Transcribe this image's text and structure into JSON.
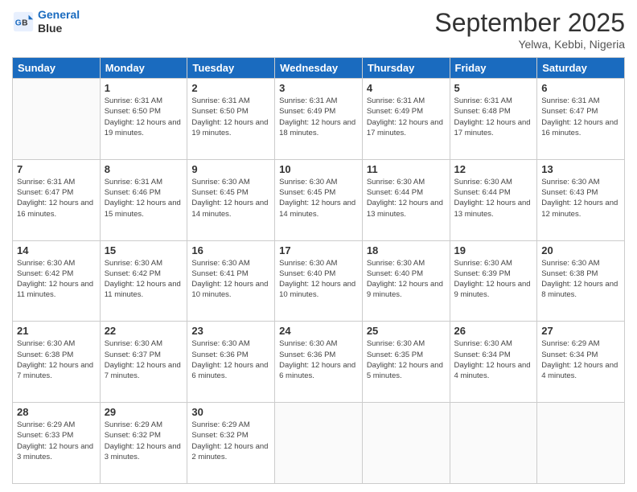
{
  "logo": {
    "line1": "General",
    "line2": "Blue"
  },
  "header": {
    "month": "September 2025",
    "location": "Yelwa, Kebbi, Nigeria"
  },
  "weekdays": [
    "Sunday",
    "Monday",
    "Tuesday",
    "Wednesday",
    "Thursday",
    "Friday",
    "Saturday"
  ],
  "weeks": [
    [
      {
        "day": "",
        "sunrise": "",
        "sunset": "",
        "daylight": ""
      },
      {
        "day": "1",
        "sunrise": "Sunrise: 6:31 AM",
        "sunset": "Sunset: 6:50 PM",
        "daylight": "Daylight: 12 hours and 19 minutes."
      },
      {
        "day": "2",
        "sunrise": "Sunrise: 6:31 AM",
        "sunset": "Sunset: 6:50 PM",
        "daylight": "Daylight: 12 hours and 19 minutes."
      },
      {
        "day": "3",
        "sunrise": "Sunrise: 6:31 AM",
        "sunset": "Sunset: 6:49 PM",
        "daylight": "Daylight: 12 hours and 18 minutes."
      },
      {
        "day": "4",
        "sunrise": "Sunrise: 6:31 AM",
        "sunset": "Sunset: 6:49 PM",
        "daylight": "Daylight: 12 hours and 17 minutes."
      },
      {
        "day": "5",
        "sunrise": "Sunrise: 6:31 AM",
        "sunset": "Sunset: 6:48 PM",
        "daylight": "Daylight: 12 hours and 17 minutes."
      },
      {
        "day": "6",
        "sunrise": "Sunrise: 6:31 AM",
        "sunset": "Sunset: 6:47 PM",
        "daylight": "Daylight: 12 hours and 16 minutes."
      }
    ],
    [
      {
        "day": "7",
        "sunrise": "Sunrise: 6:31 AM",
        "sunset": "Sunset: 6:47 PM",
        "daylight": "Daylight: 12 hours and 16 minutes."
      },
      {
        "day": "8",
        "sunrise": "Sunrise: 6:31 AM",
        "sunset": "Sunset: 6:46 PM",
        "daylight": "Daylight: 12 hours and 15 minutes."
      },
      {
        "day": "9",
        "sunrise": "Sunrise: 6:30 AM",
        "sunset": "Sunset: 6:45 PM",
        "daylight": "Daylight: 12 hours and 14 minutes."
      },
      {
        "day": "10",
        "sunrise": "Sunrise: 6:30 AM",
        "sunset": "Sunset: 6:45 PM",
        "daylight": "Daylight: 12 hours and 14 minutes."
      },
      {
        "day": "11",
        "sunrise": "Sunrise: 6:30 AM",
        "sunset": "Sunset: 6:44 PM",
        "daylight": "Daylight: 12 hours and 13 minutes."
      },
      {
        "day": "12",
        "sunrise": "Sunrise: 6:30 AM",
        "sunset": "Sunset: 6:44 PM",
        "daylight": "Daylight: 12 hours and 13 minutes."
      },
      {
        "day": "13",
        "sunrise": "Sunrise: 6:30 AM",
        "sunset": "Sunset: 6:43 PM",
        "daylight": "Daylight: 12 hours and 12 minutes."
      }
    ],
    [
      {
        "day": "14",
        "sunrise": "Sunrise: 6:30 AM",
        "sunset": "Sunset: 6:42 PM",
        "daylight": "Daylight: 12 hours and 11 minutes."
      },
      {
        "day": "15",
        "sunrise": "Sunrise: 6:30 AM",
        "sunset": "Sunset: 6:42 PM",
        "daylight": "Daylight: 12 hours and 11 minutes."
      },
      {
        "day": "16",
        "sunrise": "Sunrise: 6:30 AM",
        "sunset": "Sunset: 6:41 PM",
        "daylight": "Daylight: 12 hours and 10 minutes."
      },
      {
        "day": "17",
        "sunrise": "Sunrise: 6:30 AM",
        "sunset": "Sunset: 6:40 PM",
        "daylight": "Daylight: 12 hours and 10 minutes."
      },
      {
        "day": "18",
        "sunrise": "Sunrise: 6:30 AM",
        "sunset": "Sunset: 6:40 PM",
        "daylight": "Daylight: 12 hours and 9 minutes."
      },
      {
        "day": "19",
        "sunrise": "Sunrise: 6:30 AM",
        "sunset": "Sunset: 6:39 PM",
        "daylight": "Daylight: 12 hours and 9 minutes."
      },
      {
        "day": "20",
        "sunrise": "Sunrise: 6:30 AM",
        "sunset": "Sunset: 6:38 PM",
        "daylight": "Daylight: 12 hours and 8 minutes."
      }
    ],
    [
      {
        "day": "21",
        "sunrise": "Sunrise: 6:30 AM",
        "sunset": "Sunset: 6:38 PM",
        "daylight": "Daylight: 12 hours and 7 minutes."
      },
      {
        "day": "22",
        "sunrise": "Sunrise: 6:30 AM",
        "sunset": "Sunset: 6:37 PM",
        "daylight": "Daylight: 12 hours and 7 minutes."
      },
      {
        "day": "23",
        "sunrise": "Sunrise: 6:30 AM",
        "sunset": "Sunset: 6:36 PM",
        "daylight": "Daylight: 12 hours and 6 minutes."
      },
      {
        "day": "24",
        "sunrise": "Sunrise: 6:30 AM",
        "sunset": "Sunset: 6:36 PM",
        "daylight": "Daylight: 12 hours and 6 minutes."
      },
      {
        "day": "25",
        "sunrise": "Sunrise: 6:30 AM",
        "sunset": "Sunset: 6:35 PM",
        "daylight": "Daylight: 12 hours and 5 minutes."
      },
      {
        "day": "26",
        "sunrise": "Sunrise: 6:30 AM",
        "sunset": "Sunset: 6:34 PM",
        "daylight": "Daylight: 12 hours and 4 minutes."
      },
      {
        "day": "27",
        "sunrise": "Sunrise: 6:29 AM",
        "sunset": "Sunset: 6:34 PM",
        "daylight": "Daylight: 12 hours and 4 minutes."
      }
    ],
    [
      {
        "day": "28",
        "sunrise": "Sunrise: 6:29 AM",
        "sunset": "Sunset: 6:33 PM",
        "daylight": "Daylight: 12 hours and 3 minutes."
      },
      {
        "day": "29",
        "sunrise": "Sunrise: 6:29 AM",
        "sunset": "Sunset: 6:32 PM",
        "daylight": "Daylight: 12 hours and 3 minutes."
      },
      {
        "day": "30",
        "sunrise": "Sunrise: 6:29 AM",
        "sunset": "Sunset: 6:32 PM",
        "daylight": "Daylight: 12 hours and 2 minutes."
      },
      {
        "day": "",
        "sunrise": "",
        "sunset": "",
        "daylight": ""
      },
      {
        "day": "",
        "sunrise": "",
        "sunset": "",
        "daylight": ""
      },
      {
        "day": "",
        "sunrise": "",
        "sunset": "",
        "daylight": ""
      },
      {
        "day": "",
        "sunrise": "",
        "sunset": "",
        "daylight": ""
      }
    ]
  ]
}
